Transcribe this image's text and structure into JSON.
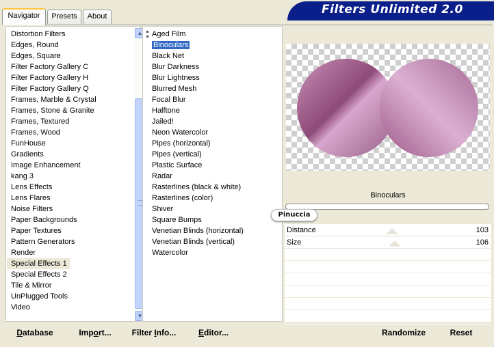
{
  "tabs": [
    {
      "label": "Navigator",
      "active": true
    },
    {
      "label": "Presets",
      "active": false
    },
    {
      "label": "About",
      "active": false
    }
  ],
  "app_title": "Filters Unlimited 2.0",
  "categories": [
    "Distortion Filters",
    "Edges, Round",
    "Edges, Square",
    "Filter Factory Gallery C",
    "Filter Factory Gallery H",
    "Filter Factory Gallery Q",
    "Frames, Marble & Crystal",
    "Frames, Stone & Granite",
    "Frames, Textured",
    "Frames, Wood",
    "FunHouse",
    "Gradients",
    "Image Enhancement",
    "kang 3",
    "Lens Effects",
    "Lens Flares",
    "Noise Filters",
    "Paper Backgrounds",
    "Paper Textures",
    "Pattern Generators",
    "Render",
    "Special Effects 1",
    "Special Effects 2",
    "Tile & Mirror",
    "UnPlugged Tools",
    "Video"
  ],
  "selected_category": "Special Effects 1",
  "filters": [
    "Aged Film",
    "Binoculars",
    "Black Net",
    "Blur Darkness",
    "Blur Lightness",
    "Blurred Mesh",
    "Focal Blur",
    "Halftone",
    "Jailed!",
    "Neon Watercolor",
    "Pipes (horizontal)",
    "Pipes (vertical)",
    "Plastic Surface",
    "Radar",
    "Rasterlines (black & white)",
    "Rasterlines (color)",
    "Shiver",
    "Square Bumps",
    "Venetian Blinds (horizontal)",
    "Venetian Blinds (vertical)",
    "Watercolor"
  ],
  "selected_filter": "Binoculars",
  "filter_title": "Binoculars",
  "watermark": "Pinuccia",
  "params": [
    {
      "label": "Distance",
      "value": "103",
      "level": 0.4
    },
    {
      "label": "Size",
      "value": "106",
      "level": 0.42
    }
  ],
  "buttons": {
    "database": {
      "u": "D",
      "rest": "atabase"
    },
    "import": {
      "pre": "Imp",
      "u": "o",
      "rest": "rt..."
    },
    "filter_info": {
      "pre": "Filter ",
      "u": "I",
      "rest": "nfo..."
    },
    "editor": {
      "u": "E",
      "rest": "ditor..."
    },
    "randomize": "Randomize",
    "reset": "Reset"
  },
  "colors": {
    "accent_selected": "#316ac5",
    "banner": "#0b1f8a",
    "preview_shape": "#a05c8a"
  }
}
